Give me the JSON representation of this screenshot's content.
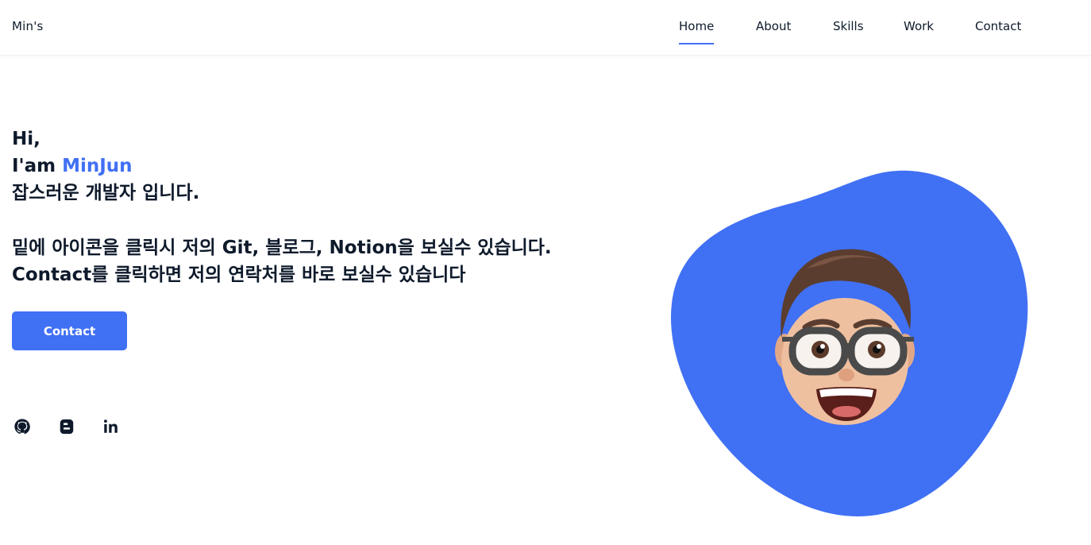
{
  "header": {
    "logo": "Min's",
    "nav": [
      {
        "label": "Home",
        "active": true
      },
      {
        "label": "About"
      },
      {
        "label": "Skills"
      },
      {
        "label": "Work"
      },
      {
        "label": "Contact"
      }
    ]
  },
  "hero": {
    "greeting": "Hi,",
    "intro_prefix": "I'am ",
    "name": "MinJun",
    "tagline": "잡스러운 개발자 입니다.",
    "description_line1": "밑에 아이콘을 클릭시 저의 Git, 블로그, Notion을 보실수 있습니다.",
    "description_line2": "Contact를 클릭하면 저의 연락처를 바로 보실수 있습니다",
    "contact_button": "Contact"
  },
  "social": [
    {
      "icon": "github-icon"
    },
    {
      "icon": "blogger-icon"
    },
    {
      "icon": "linkedin-icon"
    }
  ],
  "colors": {
    "accent": "#4070f4",
    "text": "#0e1a2b",
    "background": "#ffffff"
  }
}
